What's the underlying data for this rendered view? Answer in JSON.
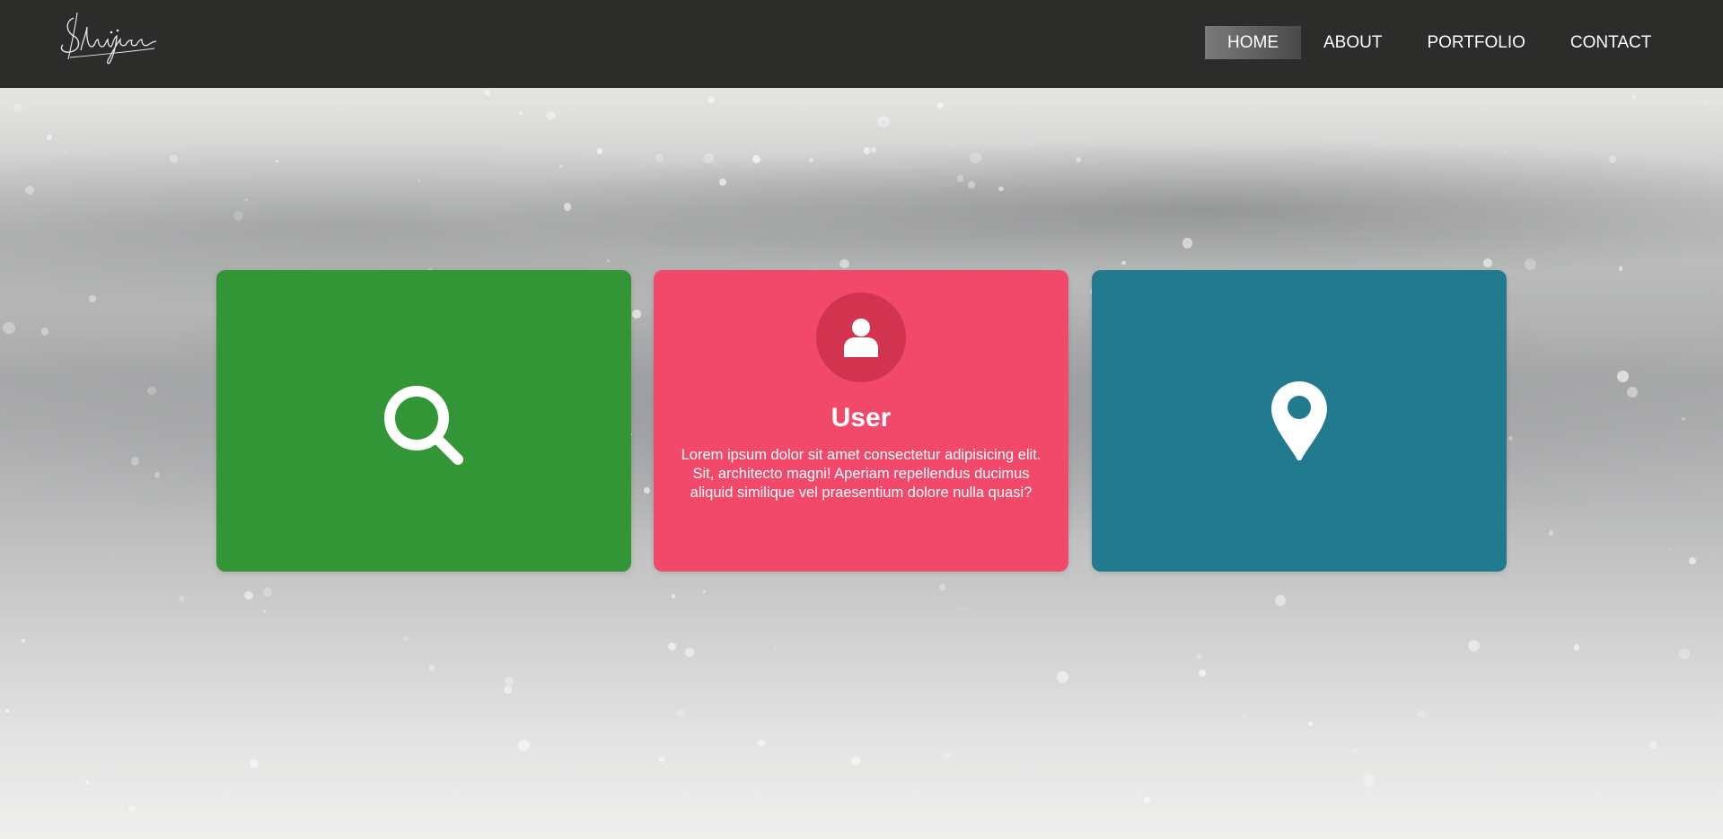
{
  "logo": {
    "text": "Shrijan",
    "icon": "script-signature-logo"
  },
  "nav": {
    "items": [
      {
        "label": "HOME",
        "active": true
      },
      {
        "label": "ABOUT",
        "active": false
      },
      {
        "label": "PORTFOLIO",
        "active": false
      },
      {
        "label": "CONTACT",
        "active": false
      }
    ]
  },
  "cards": [
    {
      "color": "#339636",
      "icon": "search-icon"
    },
    {
      "color": "#f2496a",
      "icon": "user-icon",
      "title": "User",
      "text": "Lorem ipsum dolor sit amet consectetur adipisicing elit. Sit, architecto magni! Aperiam repellendus ducimus aliquid similique vel praesentium dolore nulla quasi?"
    },
    {
      "color": "#227a8e",
      "icon": "map-pin-icon"
    }
  ],
  "colors": {
    "header_bg": "#2c2c2b",
    "nav_active_bg": "#6e6e6e",
    "avatar_bg": "#d2334f"
  }
}
